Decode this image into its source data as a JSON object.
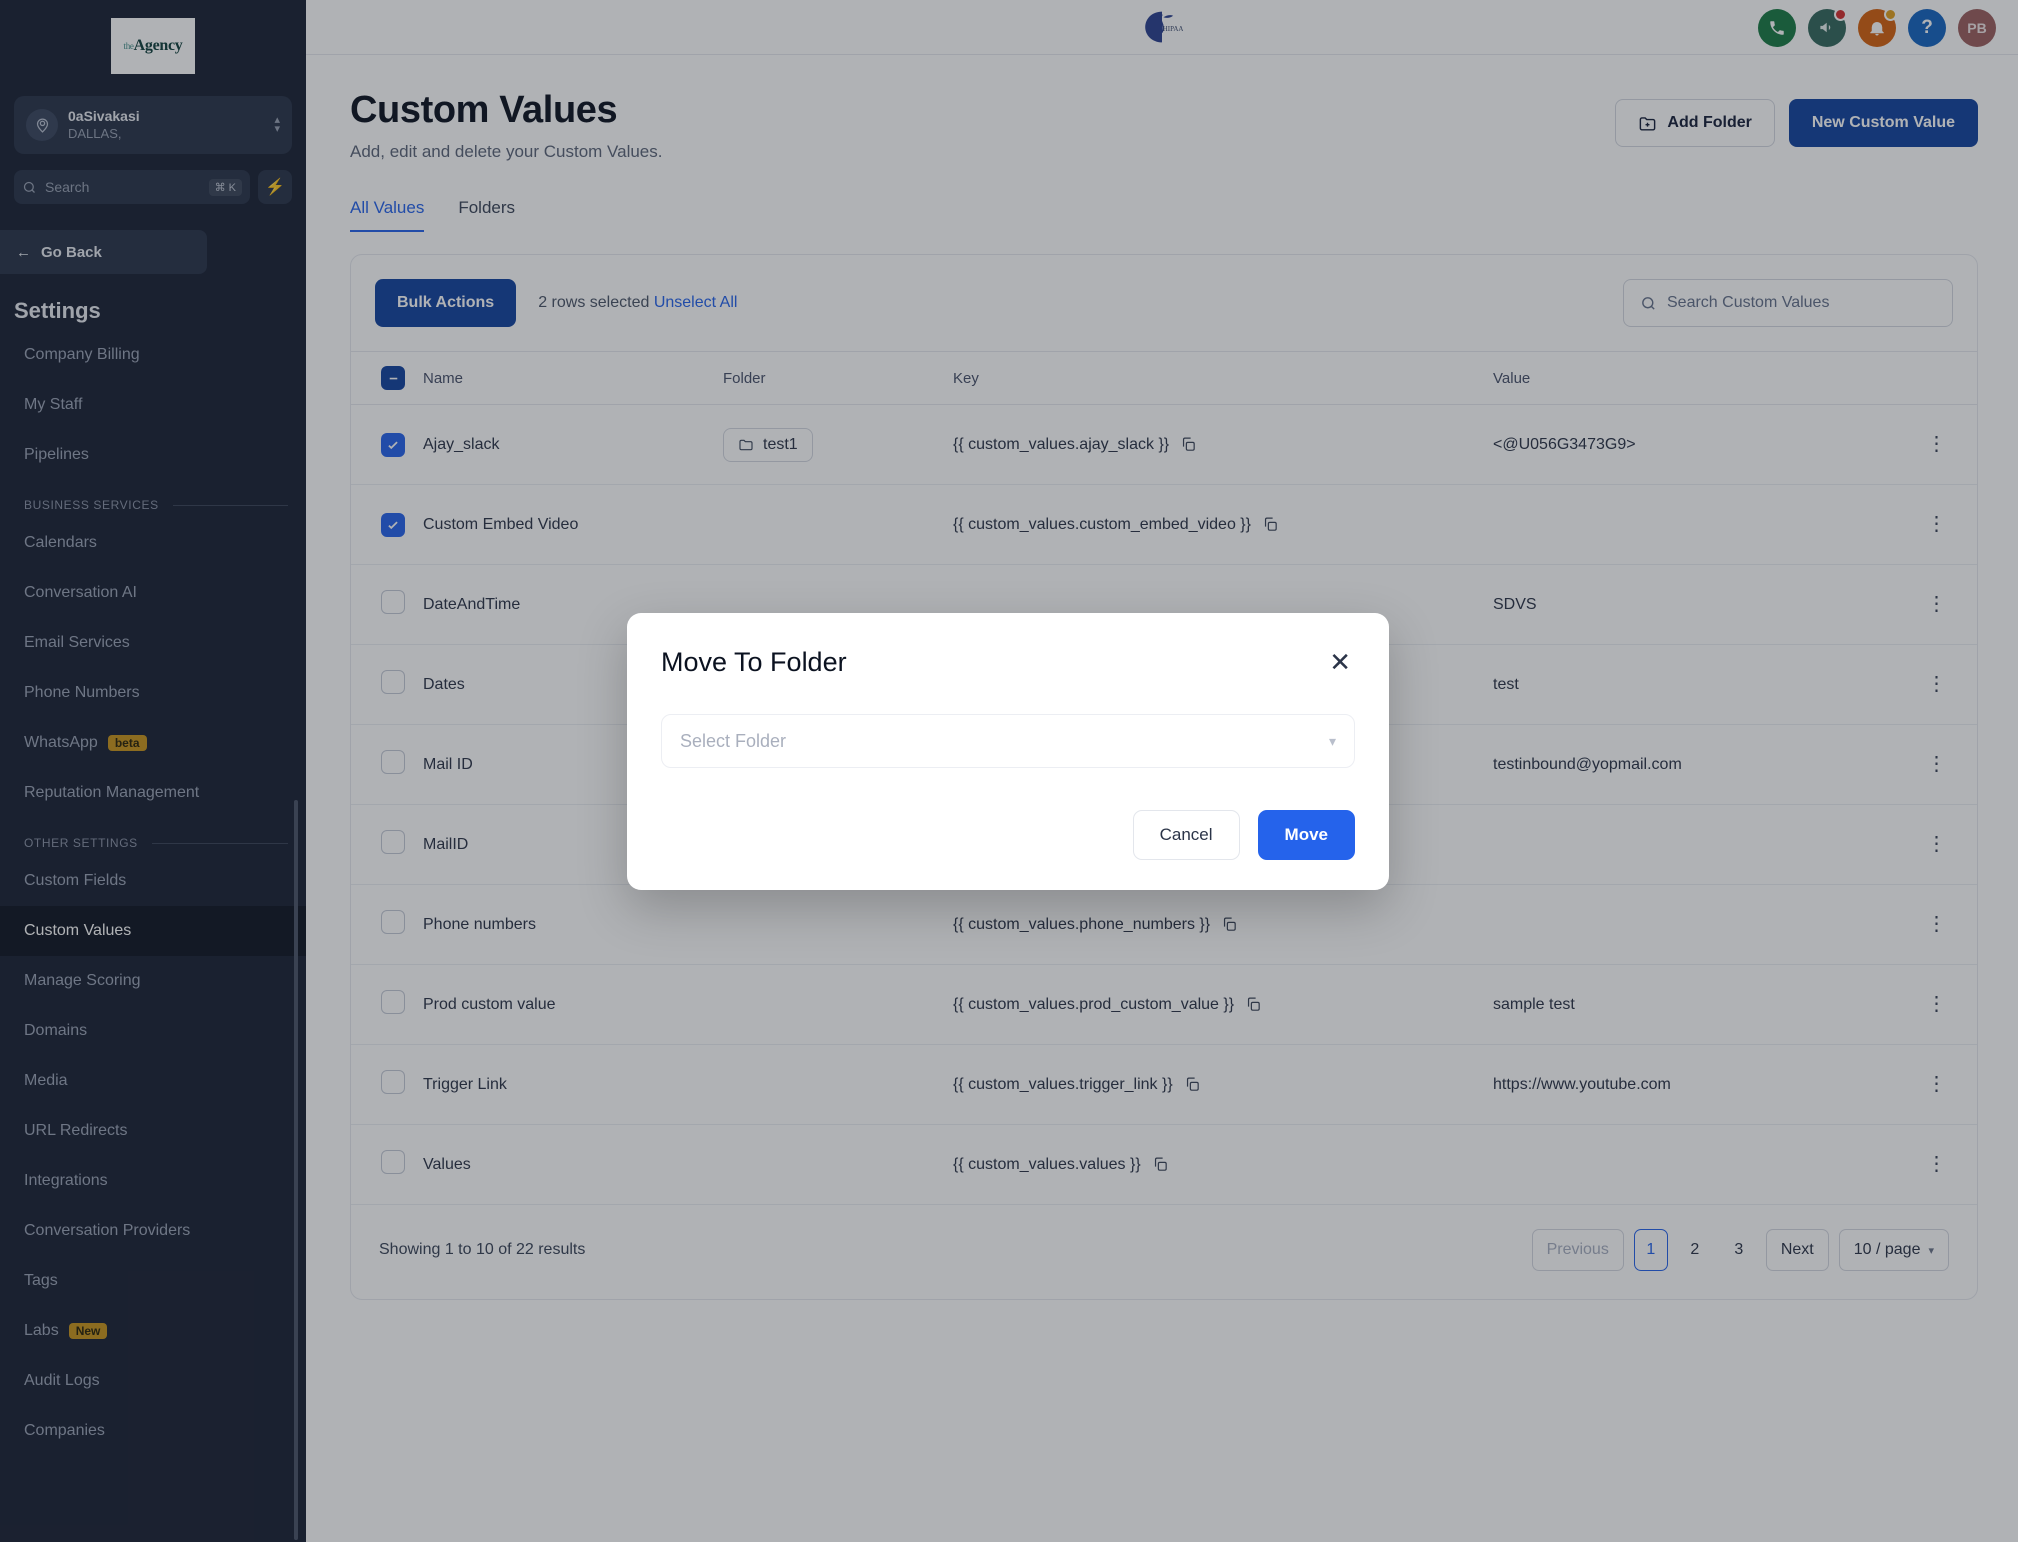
{
  "sidebar": {
    "logo": {
      "prefix": "the",
      "name": "Agency"
    },
    "account": {
      "name": "0aSivakasi",
      "location": "DALLAS,"
    },
    "search": {
      "placeholder": "Search",
      "shortcut": "⌘ K",
      "bolt_icon": "lightning-icon"
    },
    "go_back": "Go Back",
    "title": "Settings",
    "items": [
      {
        "label": "Company Billing",
        "type": "item"
      },
      {
        "label": "My Staff",
        "type": "item"
      },
      {
        "label": "Pipelines",
        "type": "item"
      },
      {
        "label": "BUSINESS SERVICES",
        "type": "section"
      },
      {
        "label": "Calendars",
        "type": "item"
      },
      {
        "label": "Conversation AI",
        "type": "item"
      },
      {
        "label": "Email Services",
        "type": "item"
      },
      {
        "label": "Phone Numbers",
        "type": "item"
      },
      {
        "label": "WhatsApp",
        "type": "item",
        "badge": "beta"
      },
      {
        "label": "Reputation Management",
        "type": "item"
      },
      {
        "label": "OTHER SETTINGS",
        "type": "section"
      },
      {
        "label": "Custom Fields",
        "type": "item"
      },
      {
        "label": "Custom Values",
        "type": "item",
        "active": true
      },
      {
        "label": "Manage Scoring",
        "type": "item"
      },
      {
        "label": "Domains",
        "type": "item"
      },
      {
        "label": "Media",
        "type": "item"
      },
      {
        "label": "URL Redirects",
        "type": "item"
      },
      {
        "label": "Integrations",
        "type": "item"
      },
      {
        "label": "Conversation Providers",
        "type": "item"
      },
      {
        "label": "Tags",
        "type": "item"
      },
      {
        "label": "Labs",
        "type": "item",
        "badge": "New"
      },
      {
        "label": "Audit Logs",
        "type": "item"
      },
      {
        "label": "Companies",
        "type": "item"
      }
    ]
  },
  "topbar": {
    "brand_logo": "hipaa-logo",
    "actions": [
      {
        "icon": "phone-icon",
        "glyph": "☎",
        "color": "#1a7a44",
        "dot": null
      },
      {
        "icon": "megaphone-icon",
        "glyph": "὎3",
        "color": "#33685c",
        "dot": "#d32f2f"
      },
      {
        "icon": "bell-icon",
        "glyph": "ὑ4",
        "color": "#d4620e",
        "dot": "#e0a020"
      },
      {
        "icon": "help-icon",
        "glyph": "?",
        "color": "#1565c0",
        "dot": null
      }
    ],
    "avatar": {
      "initials": "PB",
      "color": "#9b5f5f"
    }
  },
  "page": {
    "title": "Custom Values",
    "subtitle": "Add, edit and delete your Custom Values.",
    "add_folder_label": "Add Folder",
    "add_folder_icon": "folder-plus-icon",
    "new_custom_value_label": "New Custom Value",
    "tabs": [
      {
        "label": "All Values",
        "active": true
      },
      {
        "label": "Folders",
        "active": false
      }
    ]
  },
  "toolbar": {
    "bulk_actions_label": "Bulk Actions",
    "selection_text": "2 rows selected",
    "unselect_all_label": "Unselect All",
    "search_placeholder": "Search Custom Values",
    "search_icon": "search-icon"
  },
  "table": {
    "header_checkbox_state": "indeterminate",
    "columns": [
      "Name",
      "Folder",
      "Key",
      "Value"
    ],
    "rows": [
      {
        "checked": true,
        "name": "Ajay_slack",
        "folder": "test1",
        "key": "{{ custom_values.ajay_slack }}",
        "value": "<@U056G3473G9>"
      },
      {
        "checked": true,
        "name": "Custom Embed Video",
        "folder": "",
        "key": "{{ custom_values.custom_embed_video }}",
        "value": ""
      },
      {
        "checked": false,
        "name": "DateAndTime",
        "folder": "",
        "key": "",
        "value": "SDVS"
      },
      {
        "checked": false,
        "name": "Dates",
        "folder": "",
        "key": "",
        "value": "test"
      },
      {
        "checked": false,
        "name": "Mail ID",
        "folder": "",
        "key": "",
        "value": "testinbound@yopmail.com"
      },
      {
        "checked": false,
        "name": "MailID",
        "folder": "",
        "key": "",
        "value": ""
      },
      {
        "checked": false,
        "name": "Phone numbers",
        "folder": "",
        "key": "{{ custom_values.phone_numbers }}",
        "value": ""
      },
      {
        "checked": false,
        "name": "Prod custom value",
        "folder": "",
        "key": "{{ custom_values.prod_custom_value }}",
        "value": "sample test"
      },
      {
        "checked": false,
        "name": "Trigger Link",
        "folder": "",
        "key": "{{ custom_values.trigger_link }}",
        "value": "https://www.youtube.com"
      },
      {
        "checked": false,
        "name": "Values",
        "folder": "",
        "key": "{{ custom_values.values }}",
        "value": ""
      }
    ]
  },
  "pagination": {
    "showing": "Showing 1 to 10 of 22 results",
    "previous_label": "Previous",
    "pages": [
      "1",
      "2",
      "3"
    ],
    "current_page": "1",
    "next_label": "Next",
    "page_size_label": "10 / page"
  },
  "modal": {
    "title": "Move To Folder",
    "close_icon": "close-icon",
    "select_placeholder": "Select Folder",
    "chevron_icon": "chevron-down-icon",
    "cancel_label": "Cancel",
    "move_label": "Move"
  },
  "colors": {
    "primary_blue": "#12429e",
    "accent_blue": "#2563eb",
    "sidebar_bg": "#1a2133",
    "badge_amber": "#c8941b"
  }
}
